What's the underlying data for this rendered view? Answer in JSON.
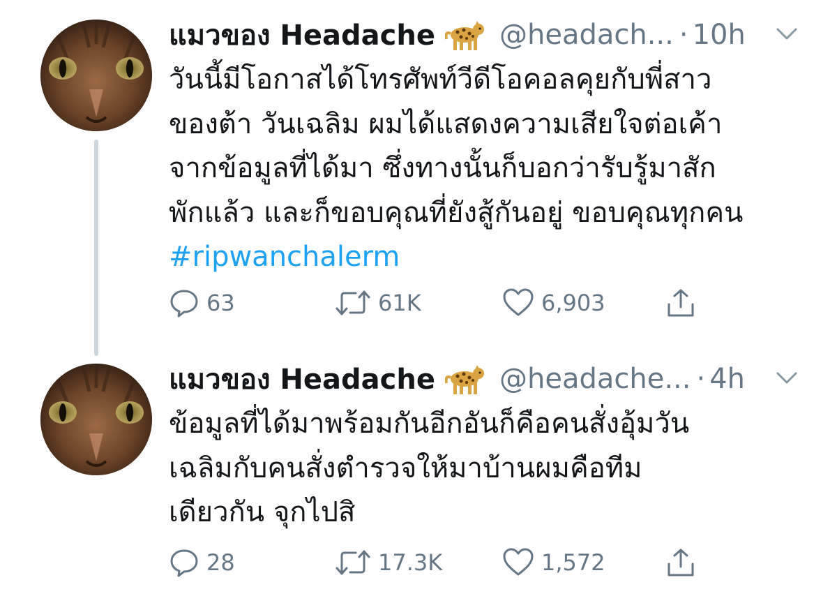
{
  "tweets": [
    {
      "display_name": "แมวของ Headache",
      "emoji": "leopard",
      "handle": "@headach...",
      "separator": "·",
      "time": "10h",
      "lines": [
        "วันนี้มีโอกาสได้โทรศัพท์วีดีโอคอลคุยกับพี่สาว",
        "ของต้า วันเฉลิม ผมได้แสดงความเสียใจต่อเค้า",
        "จากข้อมูลที่ได้มา ซึ่งทางนั้นก็บอกว่ารับรู้มาสัก",
        "พักแล้ว และก็ขอบคุณที่ยังสู้กันอยู่ ขอบคุณทุกคน"
      ],
      "hashtag": "#ripwanchalerm",
      "replies": "63",
      "retweets": "61K",
      "likes": "6,903"
    },
    {
      "display_name": "แมวของ Headache",
      "emoji": "leopard",
      "handle": "@headache...",
      "separator": "·",
      "time": "4h",
      "lines": [
        "ข้อมูลที่ได้มาพร้อมกันอีกอันก็คือคนสั่งอุ้มวัน",
        "เฉลิมกับคนสั่งตำรวจให้มาบ้านผมคือทีม",
        "เดียวกัน จุกไปสิ"
      ],
      "replies": "28",
      "retweets": "17.3K",
      "likes": "1,572"
    }
  ],
  "colors": {
    "text": "#14171a",
    "secondary": "#657786",
    "hashtag": "#1da1f2",
    "thread_line": "#ccd6dd"
  },
  "icons": {
    "reply": "speech-bubble-icon",
    "retweet": "retweet-arrows-icon",
    "like": "heart-icon",
    "share": "share-upload-icon",
    "menu": "chevron-down-icon"
  }
}
